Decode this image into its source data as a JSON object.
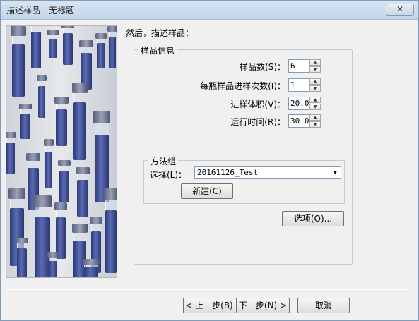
{
  "window": {
    "title": "描述样品 - 无标题",
    "close_glyph": "✕"
  },
  "heading": "然后，描述样品：",
  "sample_info": {
    "legend": "样品信息",
    "fields": [
      {
        "label": "样品数(S)：",
        "value": "6"
      },
      {
        "label": "每瓶样品进样次数(I)：",
        "value": "1"
      },
      {
        "label": "进样体积(V)：",
        "value": "20.0"
      },
      {
        "label": "运行时间(R)：",
        "value": "30.0("
      }
    ]
  },
  "method_group": {
    "legend": "方法组",
    "select_label": "选择(L)：",
    "selected_value": "20161126_Test",
    "new_button": "新建(C)"
  },
  "options_button": "选项(O)...",
  "footer": {
    "back_button": "< 上一步(B)",
    "next_button": "下一步(N) >",
    "cancel_button": "取消"
  },
  "icons": {
    "spin_up": "▲",
    "spin_down": "▼",
    "dropdown": "▼"
  }
}
